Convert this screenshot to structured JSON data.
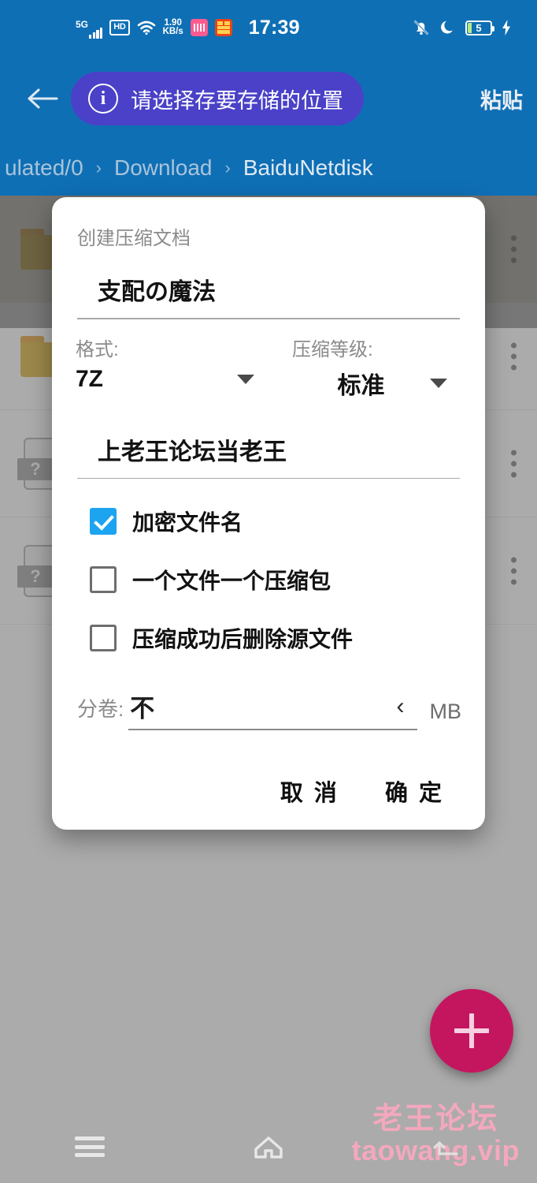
{
  "statusbar": {
    "network_type": "5G",
    "hd_label": "HD",
    "net_speed_value": "1.90",
    "net_speed_unit": "KB/s",
    "clock": "17:39",
    "battery_level": "5",
    "icons": [
      "signal-bars-icon",
      "hd-icon",
      "wifi-icon",
      "bilibili-app-icon",
      "orange-app-icon",
      "bell-muted-icon",
      "do-not-disturb-moon-icon",
      "battery-icon",
      "charging-bolt-icon"
    ]
  },
  "actionbar": {
    "back_label": "←",
    "info_icon": "i",
    "info_text": "请选择存要存储的位置",
    "paste_label": "粘贴"
  },
  "breadcrumb": {
    "items": [
      {
        "label": "ulated/0",
        "current": false
      },
      {
        "label": "Download",
        "current": false
      },
      {
        "label": "BaiduNetdisk",
        "current": true
      }
    ],
    "separator": "›"
  },
  "filelist": {
    "rows": [
      {
        "icon": "folder-icon",
        "name": ""
      },
      {
        "icon": "folder-icon",
        "name": ""
      },
      {
        "icon": "unknown-file-icon",
        "name": "",
        "badge": "?"
      },
      {
        "icon": "unknown-file-icon",
        "name": "",
        "badge": "?"
      }
    ]
  },
  "fab": {
    "label": "+"
  },
  "watermark": {
    "line1": "老王论坛",
    "line2": "taowang.vip"
  },
  "navbar": {
    "recents": "recents-icon",
    "home": "home-icon",
    "back": "back-icon"
  },
  "dialog": {
    "title": "创建压缩文档",
    "archive_name": "支配の魔法",
    "format": {
      "label": "格式:",
      "value": "7Z"
    },
    "level": {
      "label": "压缩等级:",
      "value": "标准"
    },
    "password": "上老王论坛当老王",
    "checkboxes": [
      {
        "label": "加密文件名",
        "checked": true
      },
      {
        "label": "一个文件一个压缩包",
        "checked": false
      },
      {
        "label": "压缩成功后删除源文件",
        "checked": false
      }
    ],
    "volume": {
      "label": "分卷:",
      "value": "不",
      "chevron": "‹",
      "unit": "MB"
    },
    "cancel_label": "取 消",
    "confirm_label": "确 定"
  },
  "colors": {
    "app_bar": "#0f6fb5",
    "info_pill": "#4a41c8",
    "checkbox_checked": "#1ca4f0",
    "fab": "#c4165f",
    "folder": "#d5a100",
    "watermark": "#f4a8bd"
  }
}
